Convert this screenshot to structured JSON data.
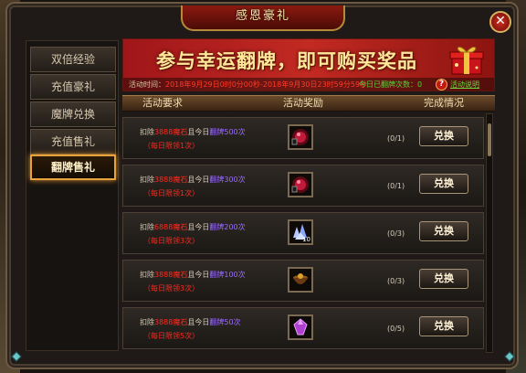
{
  "window": {
    "title": "感恩豪礼",
    "close": "✕"
  },
  "sidebar": {
    "items": [
      {
        "label": "双倍经验",
        "active": false
      },
      {
        "label": "充值豪礼",
        "active": false
      },
      {
        "label": "魔牌兑换",
        "active": false
      },
      {
        "label": "充值售礼",
        "active": false
      },
      {
        "label": "翻牌售礼",
        "active": true
      }
    ]
  },
  "banner": {
    "title": "参与幸运翻牌，即可购买奖品",
    "time_label": "活动时间：",
    "time_value": "2018年9月29日0时0分00秒-2018年9月30日23时59分59秒",
    "flips_label": "今日已翻牌次数：",
    "flips_value": "0",
    "help_icon": "?",
    "help_label": "活动说明"
  },
  "table": {
    "headers": {
      "requirement": "活动要求",
      "reward": "活动奖励",
      "status": "完成情况"
    },
    "rows": [
      {
        "deduct": "扣除",
        "diamonds": "3888魔石",
        "and": "且今日",
        "flips": "翻牌500次",
        "limit": "（每日限领1次）",
        "item": "red-orb",
        "qty": "",
        "progress": "(0/1)",
        "button": "兑换"
      },
      {
        "deduct": "扣除",
        "diamonds": "3888魔石",
        "and": "且今日",
        "flips": "翻牌300次",
        "limit": "（每日限领1次）",
        "item": "red-orb",
        "qty": "",
        "progress": "(0/1)",
        "button": "兑换"
      },
      {
        "deduct": "扣除",
        "diamonds": "6888魔石",
        "and": "且今日",
        "flips": "翻牌200次",
        "limit": "（每日限领3次）",
        "item": "crystal-pile",
        "qty": "10",
        "progress": "(0/3)",
        "button": "兑换"
      },
      {
        "deduct": "扣除",
        "diamonds": "3888魔石",
        "and": "且今日",
        "flips": "翻牌100次",
        "limit": "（每日限领3次）",
        "item": "gold-bowl",
        "qty": "",
        "progress": "(0/3)",
        "button": "兑换"
      },
      {
        "deduct": "扣除",
        "diamonds": "3888魔石",
        "and": "且今日",
        "flips": "翻牌50次",
        "limit": "（每日限领5次）",
        "item": "purple-gem",
        "qty": "",
        "progress": "(0/5)",
        "button": "兑换"
      }
    ]
  },
  "colors": {
    "accent": "#e6a23c",
    "danger": "#ff2a1e",
    "purple": "#9a6cff",
    "green": "#58d038"
  }
}
